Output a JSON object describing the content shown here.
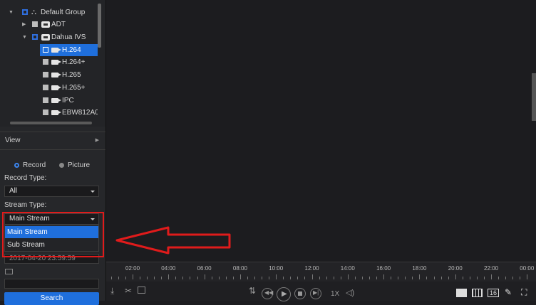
{
  "tree": {
    "root": "Default Group",
    "items": [
      {
        "label": "ADT"
      },
      {
        "label": "Dahua IVS"
      },
      {
        "label": "H.264"
      },
      {
        "label": "H.264+"
      },
      {
        "label": "H.265"
      },
      {
        "label": "H.265+"
      },
      {
        "label": "IPC"
      },
      {
        "label": "EBW812A0"
      }
    ]
  },
  "view": {
    "label": "View"
  },
  "mode": {
    "record": "Record",
    "picture": "Picture",
    "selected": "Record"
  },
  "record_type": {
    "label": "Record Type:",
    "value": "All"
  },
  "stream_type": {
    "label": "Stream Type:",
    "value": "Main Stream",
    "options": [
      "Main Stream",
      "Sub Stream"
    ]
  },
  "end_time": "2017-04-20 23:59:59",
  "search": {
    "label": "Search"
  },
  "timeline": {
    "ticks": [
      "02:00",
      "04:00",
      "06:00",
      "08:00",
      "10:00",
      "12:00",
      "14:00",
      "16:00",
      "18:00",
      "20:00",
      "22:00",
      "00:00"
    ]
  },
  "player": {
    "speed": "1X",
    "layout_16": "16"
  },
  "colors": {
    "accent": "#1f6fdc",
    "highlight_box": "#e01b1b",
    "arrow": "#e01b1b"
  }
}
